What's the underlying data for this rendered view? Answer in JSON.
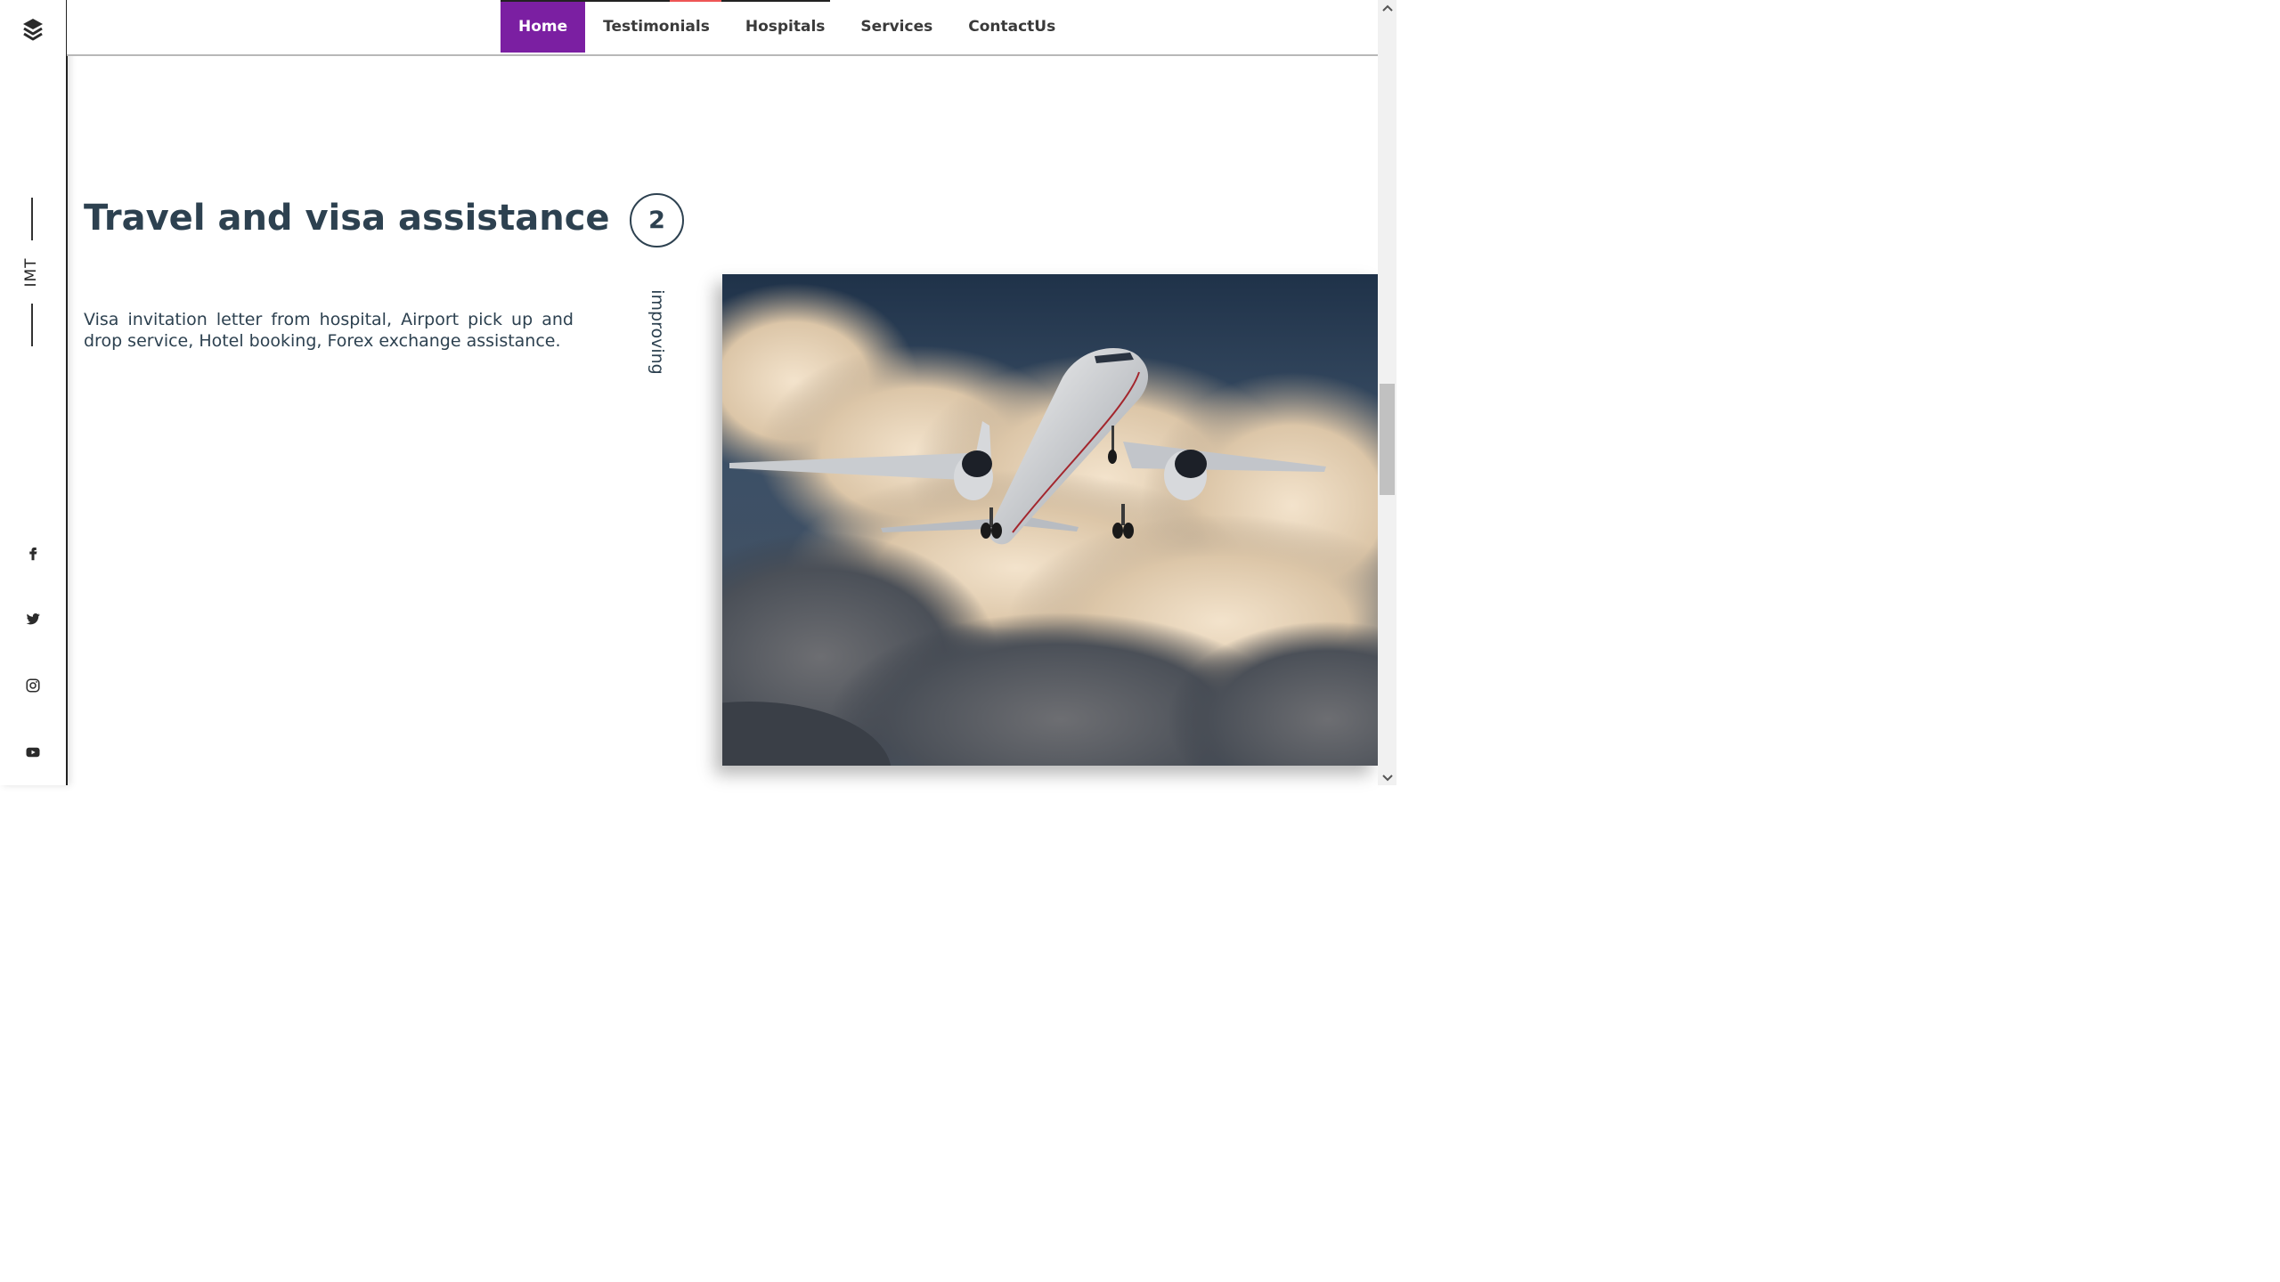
{
  "sidebar": {
    "brand": "IMT",
    "logo_icon": "layers-icon",
    "social_icons": [
      "facebook-icon",
      "twitter-icon",
      "instagram-icon",
      "youtube-icon"
    ]
  },
  "nav": {
    "items": [
      {
        "label": "Home",
        "active": true
      },
      {
        "label": "Testimonials",
        "active": false
      },
      {
        "label": "Hospitals",
        "active": false
      },
      {
        "label": "Services",
        "active": false
      },
      {
        "label": "ContactUs",
        "active": false
      }
    ]
  },
  "section": {
    "title": "Travel and visa assistance",
    "description": "Visa invitation letter from hospital, Airport pick up and drop service, Hotel booking, Forex exchange assistance.",
    "step_number": "2",
    "vertical_word": "improving",
    "image_subject": "airplane-in-clouds"
  },
  "colors": {
    "accent": "#7b1fa2",
    "text": "#2d4150",
    "sky": "#2a3c52"
  }
}
